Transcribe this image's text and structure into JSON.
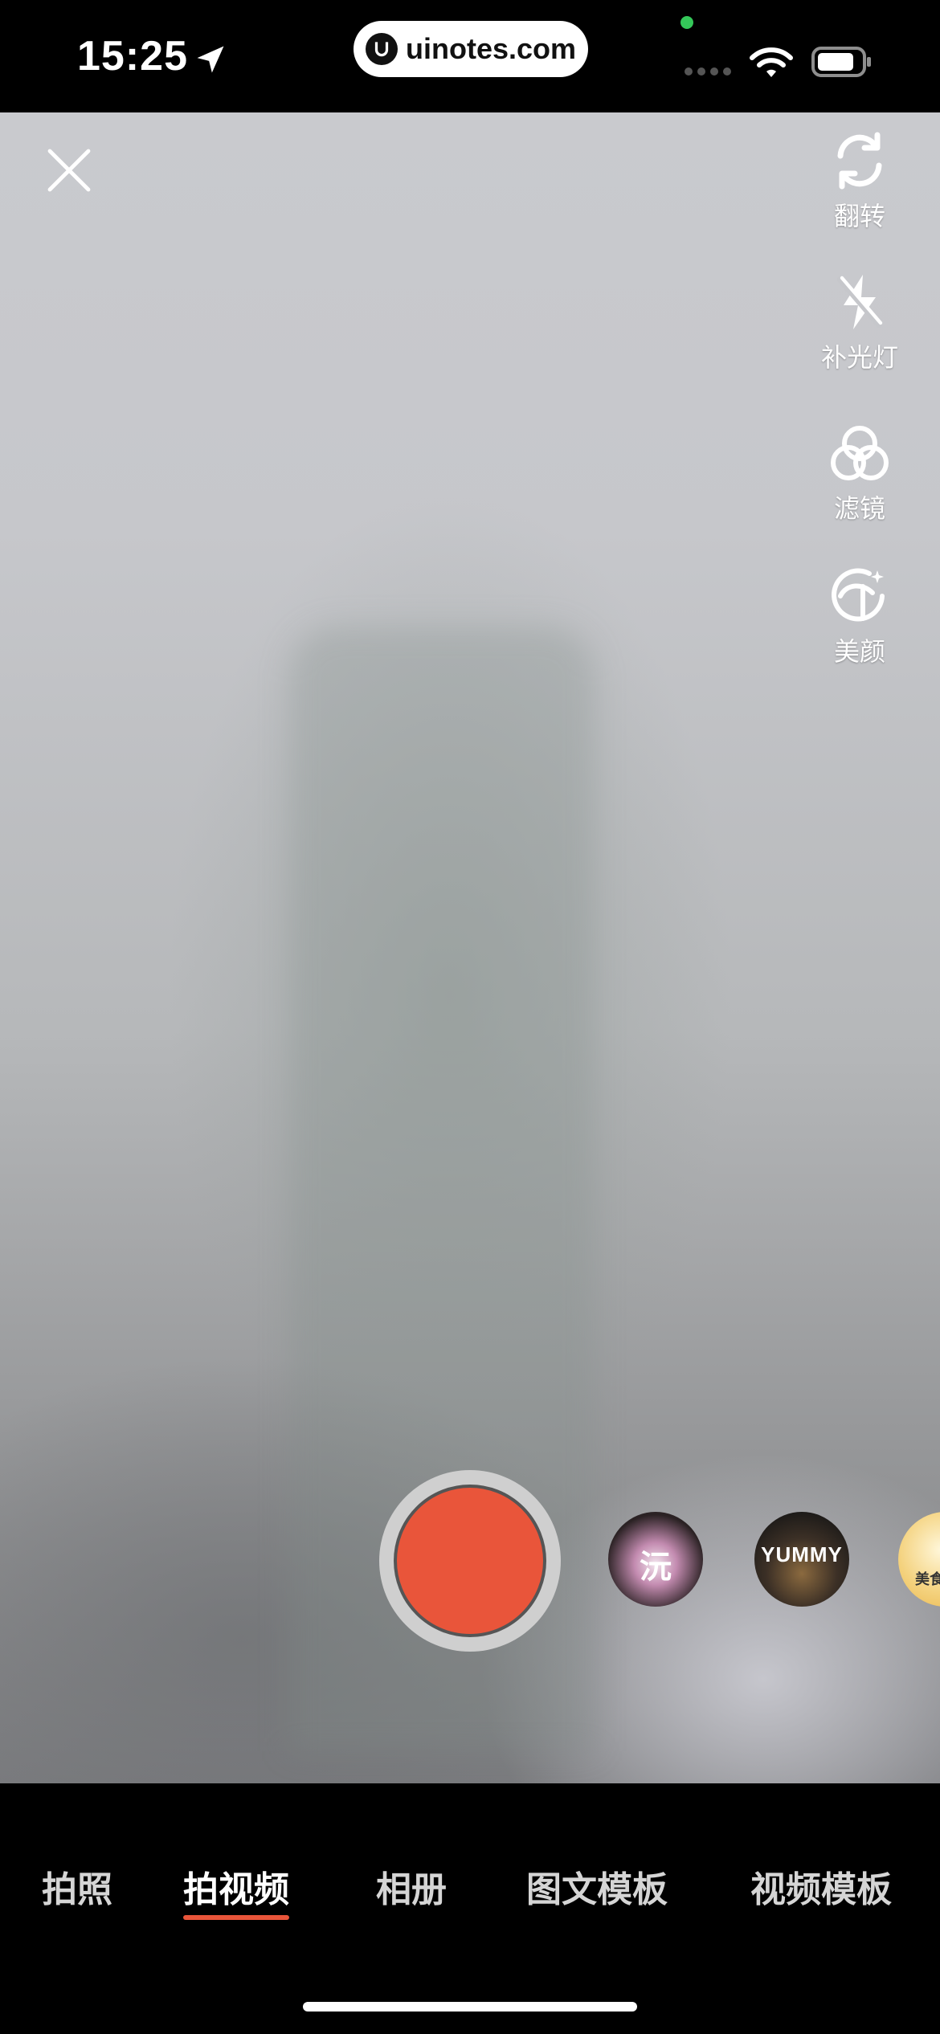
{
  "status_bar": {
    "time": "15:25",
    "url": "uinotes.com"
  },
  "camera": {
    "close_icon": "close-icon",
    "side_tools": [
      {
        "icon": "flip-camera-icon",
        "label": "翻转"
      },
      {
        "icon": "flash-off-icon",
        "label": "补光灯"
      },
      {
        "icon": "filter-icon",
        "label": "滤镜"
      },
      {
        "icon": "beauty-icon",
        "label": "美颜"
      }
    ],
    "effects": [
      {
        "text": "沅"
      },
      {
        "text": "YUMMY"
      },
      {
        "text": "美食"
      }
    ]
  },
  "tabs": [
    {
      "label": "拍照",
      "active": false
    },
    {
      "label": "拍视频",
      "active": true
    },
    {
      "label": "相册",
      "active": false
    },
    {
      "label": "图文模板",
      "active": false
    },
    {
      "label": "视频模板",
      "active": false
    }
  ],
  "colors": {
    "record": "#e9553a",
    "active_underline": "#e9553a"
  }
}
